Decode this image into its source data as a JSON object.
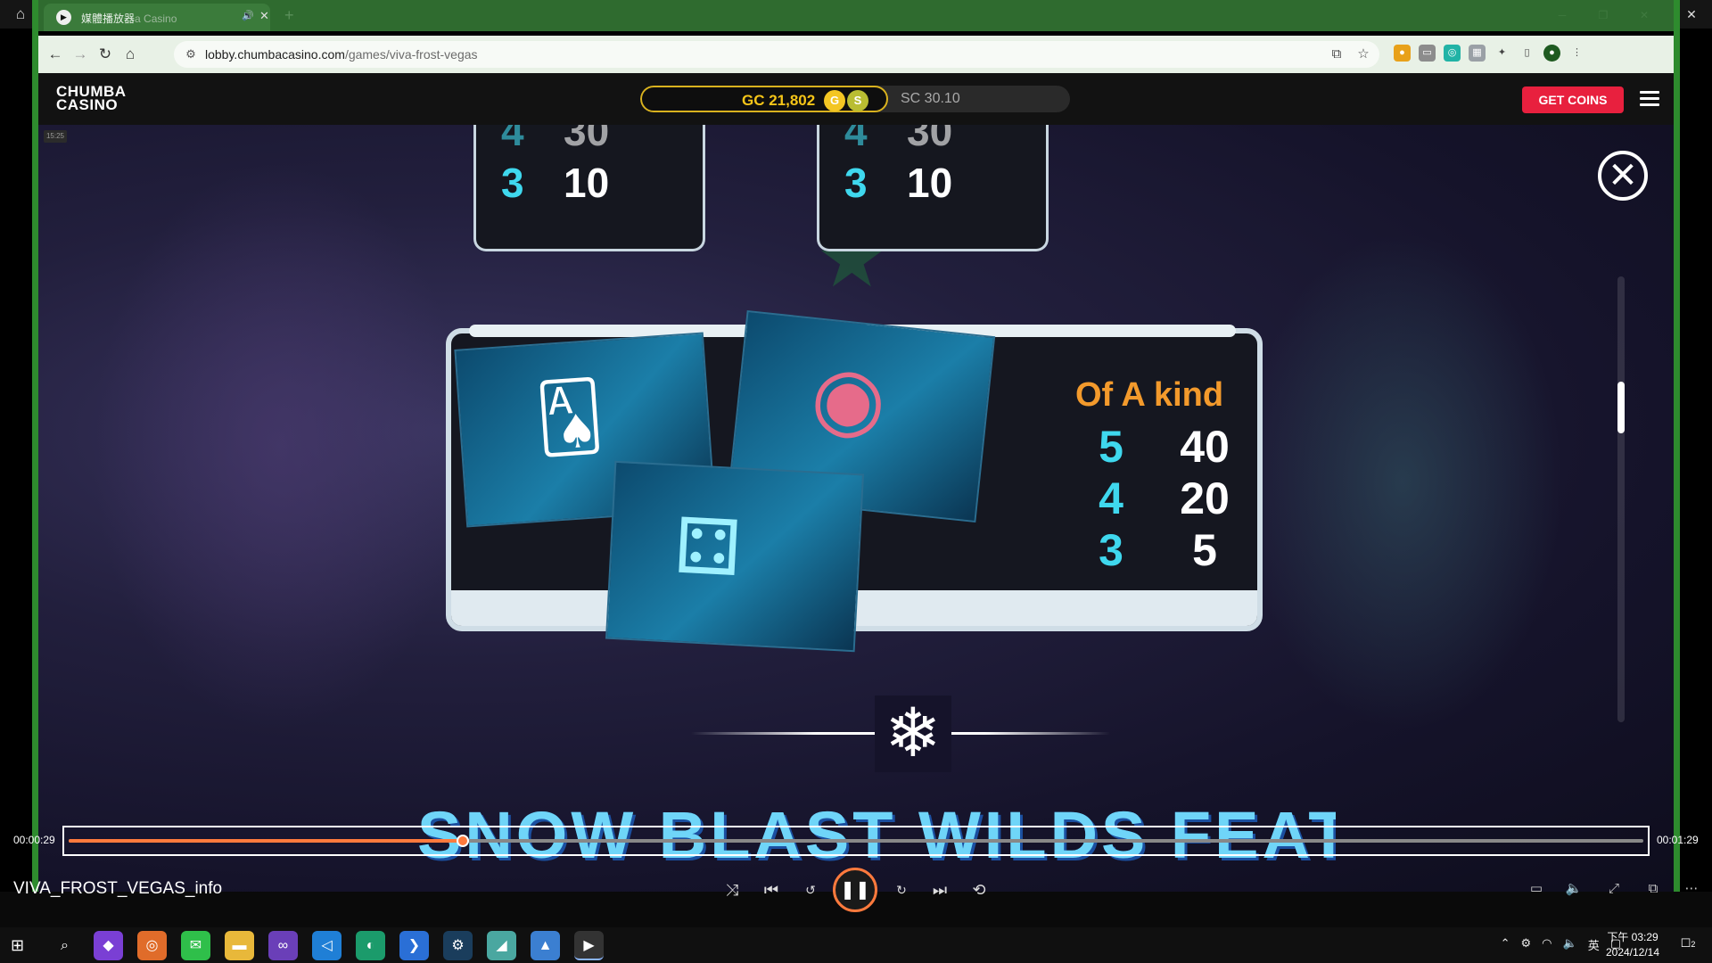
{
  "player": {
    "window_title": "媒體播放器",
    "video_title": "VIVA_FROST_VEGAS_info",
    "time_current": "00:00:29",
    "time_total": "00:01:29",
    "progress_fraction": 0.25
  },
  "browser": {
    "tab_title_visible": "媒體播放器",
    "tab_title_faded": "a Casino",
    "url_host": "lobby.chumbacasino.com",
    "url_path": "/games/viva-frost-vegas"
  },
  "site": {
    "logo_line1": "CHUMBA",
    "logo_line2": "CASINO",
    "gc_balance": "GC 21,802",
    "coin_g": "G",
    "coin_s": "S",
    "sc_balance": "SC 30.10",
    "get_coins": "GET COINS"
  },
  "game": {
    "timestamp": "15:25",
    "mini_panels": [
      {
        "count": "3",
        "payout": "10"
      },
      {
        "count": "3",
        "payout": "10"
      }
    ],
    "paytable": {
      "title": "Of A kind",
      "rows": [
        {
          "count": "5",
          "payout": "40"
        },
        {
          "count": "4",
          "payout": "20"
        },
        {
          "count": "3",
          "payout": "5"
        }
      ]
    },
    "feature_title": "SNOW BLAST WILDS FEATURE"
  },
  "taskbar": {
    "time": "下午 03:29",
    "date": "2024/12/14",
    "ime": "英",
    "notification_count": "2"
  }
}
